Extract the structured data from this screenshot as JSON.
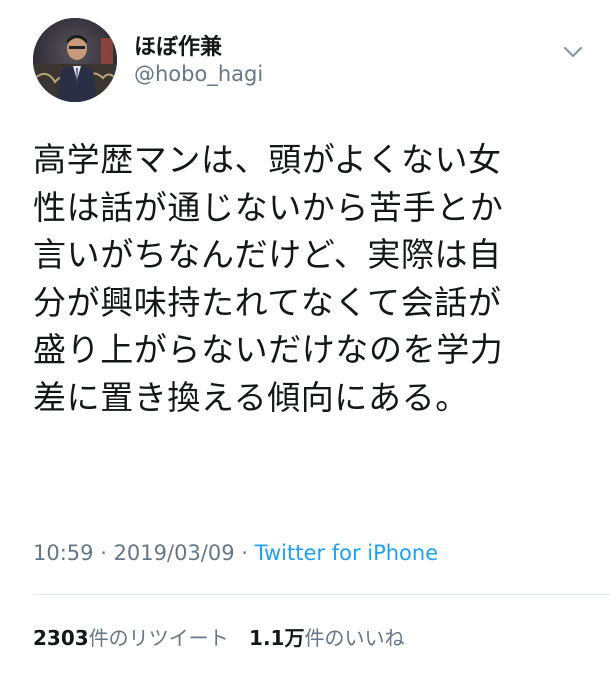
{
  "user": {
    "display_name": "ほぼ作兼",
    "handle": "@hobo_hagi",
    "avatar_icon": "profile-photo"
  },
  "tweet": {
    "lines": [
      "高学歴マンは、頭がよくない女",
      "性は話が通じないから苦手とか",
      "言いがちなんだけど、実際は自",
      "分が興味持たれてなくて会話が",
      "盛り上がらないだけなのを学力",
      "差に置き換える傾向にある。"
    ]
  },
  "meta": {
    "time": "10:59",
    "separator1": " · ",
    "date": "2019/03/09",
    "separator2": " · ",
    "source": "Twitter for iPhone"
  },
  "stats": {
    "retweets_count": "2303",
    "retweets_label": "件のリツイート",
    "likes_count": "1.1万",
    "likes_label": "件のいいね"
  },
  "colors": {
    "text": "#14171a",
    "secondary": "#657786",
    "link": "#1da1f2",
    "divider": "#e1e8ed"
  },
  "icons": {
    "menu": "chevron-down-icon"
  }
}
